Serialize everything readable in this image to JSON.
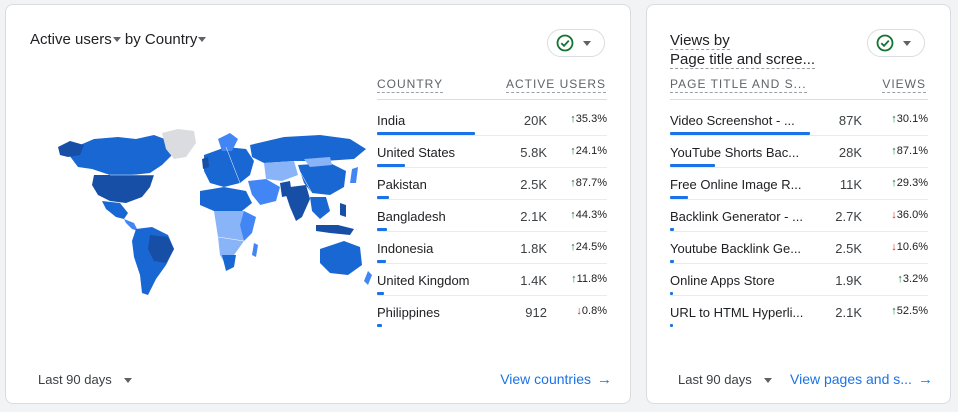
{
  "colors": {
    "accent": "#1a73e8",
    "map_dark": "#174ea6",
    "map_mid": "#1967d2",
    "map_light": "#8ab4f8",
    "map_none": "#dadce0",
    "up": "#137333",
    "down": "#c5221f"
  },
  "country_card": {
    "title_metric": "Active users",
    "title_by": "by",
    "title_dim": "Country",
    "status_icon": "check-circle-icon",
    "col_dim": "COUNTRY",
    "col_metric": "ACTIVE USERS",
    "rows": [
      {
        "name": "India",
        "value": "20K",
        "change": "35.3%",
        "dir": "up",
        "share": 1.0
      },
      {
        "name": "United States",
        "value": "5.8K",
        "change": "24.1%",
        "dir": "up",
        "share": 0.29
      },
      {
        "name": "Pakistan",
        "value": "2.5K",
        "change": "87.7%",
        "dir": "up",
        "share": 0.125
      },
      {
        "name": "Bangladesh",
        "value": "2.1K",
        "change": "44.3%",
        "dir": "up",
        "share": 0.105
      },
      {
        "name": "Indonesia",
        "value": "1.8K",
        "change": "24.5%",
        "dir": "up",
        "share": 0.09
      },
      {
        "name": "United Kingdom",
        "value": "1.4K",
        "change": "11.8%",
        "dir": "up",
        "share": 0.07
      },
      {
        "name": "Philippines",
        "value": "912",
        "change": "0.8%",
        "dir": "down",
        "share": 0.046
      }
    ],
    "date_range": "Last 90 days",
    "link": "View countries"
  },
  "pages_card": {
    "title_line1": "Views by",
    "title_line2": "Page title and scree...",
    "status_icon": "check-circle-icon",
    "col_dim": "PAGE TITLE AND S...",
    "col_metric": "VIEWS",
    "rows": [
      {
        "name": "Video Screenshot - ...",
        "value": "87K",
        "change": "30.1%",
        "dir": "up",
        "share": 1.0
      },
      {
        "name": "YouTube Shorts Bac...",
        "value": "28K",
        "change": "87.1%",
        "dir": "up",
        "share": 0.32
      },
      {
        "name": "Free Online Image R...",
        "value": "11K",
        "change": "29.3%",
        "dir": "up",
        "share": 0.13
      },
      {
        "name": "Backlink Generator - ...",
        "value": "2.7K",
        "change": "36.0%",
        "dir": "down",
        "share": 0.031
      },
      {
        "name": "Youtube Backlink Ge...",
        "value": "2.5K",
        "change": "10.6%",
        "dir": "down",
        "share": 0.029
      },
      {
        "name": "Online Apps Store",
        "value": "1.9K",
        "change": "3.2%",
        "dir": "up",
        "share": 0.022
      },
      {
        "name": "URL to HTML Hyperli...",
        "value": "2.1K",
        "change": "52.5%",
        "dir": "up",
        "share": 0.024
      }
    ],
    "date_range": "Last 90 days",
    "link": "View pages and s..."
  }
}
